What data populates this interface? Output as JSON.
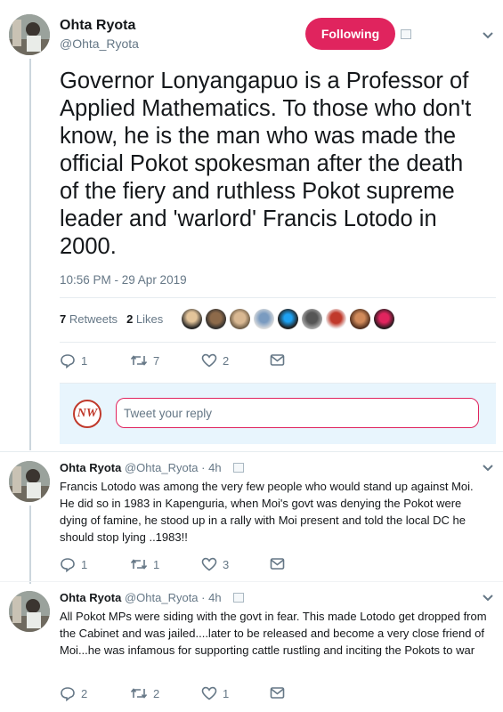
{
  "main_tweet": {
    "author_name": "Ohta Ryota",
    "author_handle": "@Ohta_Ryota",
    "follow_label": "Following",
    "text": "Governor Lonyangapuo is a Professor of Applied Mathematics. To those who don't know, he is the man who was made the official Pokot spokesman after the death of the fiery and ruthless Pokot supreme leader and 'warlord' Francis Lotodo in 2000.",
    "timestamp": "10:56 PM - 29 Apr 2019",
    "retweets_count": "7",
    "retweets_label": "Retweets",
    "likes_count": "2",
    "likes_label": "Likes",
    "reply_count": "1",
    "retweet_count": "7",
    "like_count": "2"
  },
  "reply_box": {
    "logo_text": "NW",
    "placeholder": "Tweet your reply"
  },
  "replies": [
    {
      "author_name": "Ohta Ryota",
      "author_handle": "@Ohta_Ryota",
      "time": "· 4h",
      "text": "Francis Lotodo was among the very few people who would stand up against Moi. He did so in 1983 in Kapenguria, when Moi's govt was denying the Pokot were dying of famine, he stood up in a rally with Moi present and told the local DC he should stop lying ..1983!!",
      "reply_count": "1",
      "retweet_count": "1",
      "like_count": "3"
    },
    {
      "author_name": "Ohta Ryota",
      "author_handle": "@Ohta_Ryota",
      "time": "· 4h",
      "text": "All Pokot MPs were siding with the govt in fear. This made Lotodo get dropped from the Cabinet and was jailed....later to be released and become a very close friend of Moi...he was infamous for supporting cattle rustling and inciting the Pokots to war",
      "reply_count": "2",
      "retweet_count": "2",
      "like_count": "1"
    }
  ],
  "colors": {
    "accent": "#e0245e",
    "muted": "#657786",
    "divider": "#e6ecf0",
    "reply_box_bg": "#e8f5fd"
  },
  "icons": {
    "reply": "speech-bubble-icon",
    "retweet": "retweet-arrows-icon",
    "like": "heart-icon",
    "dm": "envelope-icon",
    "more": "chevron-down-icon"
  }
}
